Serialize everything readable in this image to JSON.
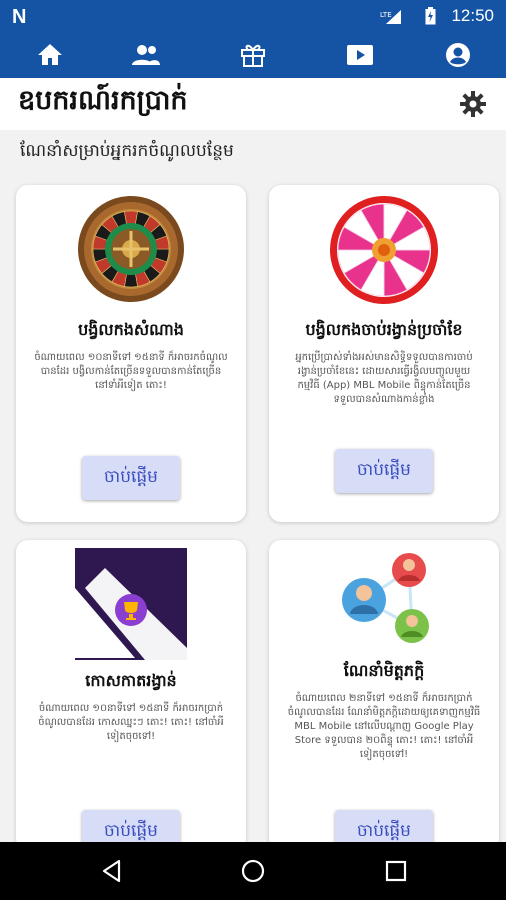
{
  "status_bar": {
    "logo": "N",
    "network": "LTE",
    "time": "12:50"
  },
  "nav": {
    "items": [
      "home-icon",
      "people-icon",
      "gift-icon",
      "play-video-icon",
      "account-icon"
    ]
  },
  "header": {
    "title": "ឧបករណ៍រកប្រាក់",
    "settings_icon": "gear-icon"
  },
  "subtitle": "ណែនាំសម្រាប់អ្នករកចំណូលបន្ថែម",
  "cards": [
    {
      "title": "បង្វិលកងសំណាង",
      "description": "ចំណាយពេល ១០នាទីទៅ ១៥នាទី ក៏អាចរកចំណូលបានដែរ បង្វិលកាន់តែច្រើនទទួលបានកាន់តែច្រើននៅទាំអីទៀត តោះ!",
      "button": "ចាប់ផ្ដើម",
      "image": "casino-roulette-wheel"
    },
    {
      "title": "បង្វិលកងចាប់រង្វាន់ប្រចាំខែ",
      "description": "អ្នកប្រើប្រាស់ទាំងអស់មានសិទ្ធិទទួលបានការចាប់រង្វាន់ប្រចាំខែនេះ ដោយសារធ្វើរង្វិលបញ្ចូលមួយកម្មវិធី (App) MBL Mobile ពិន្ទុកាន់តែច្រើនទទួលបានសំណាងកាន់ខ្លាំង",
      "button": "ចាប់ផ្ដើម",
      "image": "pink-prize-wheel"
    },
    {
      "title": "កោសកាតរង្វាន់",
      "description": "ចំណាយពេល ១០នាទីទៅ ១៥នាទី ក៏អាចរកប្រាក់ចំណូលបានដែរ កោសឈ្នះៗ តោះ! តោះ! នៅចាំអីទៀតចុចទៅ!",
      "button": "ចាប់ផ្ដើម",
      "image": "scratch-card-trophy"
    },
    {
      "title": "ណែនាំមិត្តភក្តិ",
      "description": "ចំណាយពេល ២នាទីទៅ ១៥នាទី ក៏អាចរកប្រាក់ចំណូលបានដែរ ណែនាំមិត្តភក្តិដោយឲ្យគេទាញកម្មវិធី MBL Mobile នៅលើបណ្ដាញ Google Play Store ទទួលបាន ២០ពិន្ទុ តោះ! តោះ! នៅចាំអីទៀតចុចទៅ!",
      "button": "ចាប់ផ្ដើម",
      "image": "refer-friends-network"
    }
  ],
  "system_nav": [
    "back-icon",
    "home-circle-icon",
    "recents-icon"
  ]
}
